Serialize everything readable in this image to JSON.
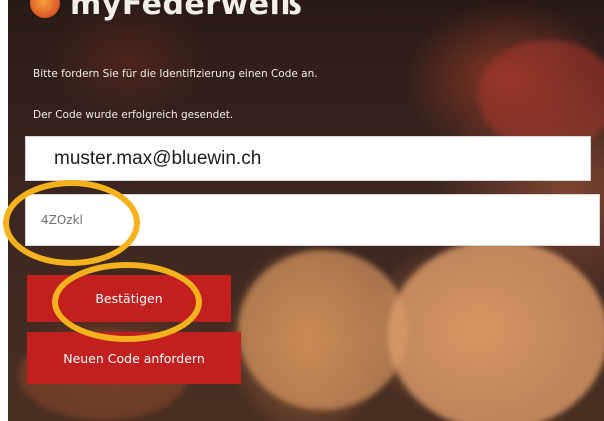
{
  "header": {
    "brand": "myFederweiß"
  },
  "form": {
    "instruction": "Bitte fordern Sie für die Identifizierung einen Code an.",
    "success_message": "Der Code wurde erfolgreich gesendet.",
    "email_value": "muster.max@bluewin.ch",
    "code_value": "4ZOzkl",
    "confirm_label": "Bestätigen",
    "new_code_label": "Neuen Code anfordern"
  },
  "colors": {
    "button": "#c21f1f",
    "highlight": "#f4b21c",
    "text_light": "#f1ece4"
  },
  "icons": [
    "logo-icon"
  ]
}
